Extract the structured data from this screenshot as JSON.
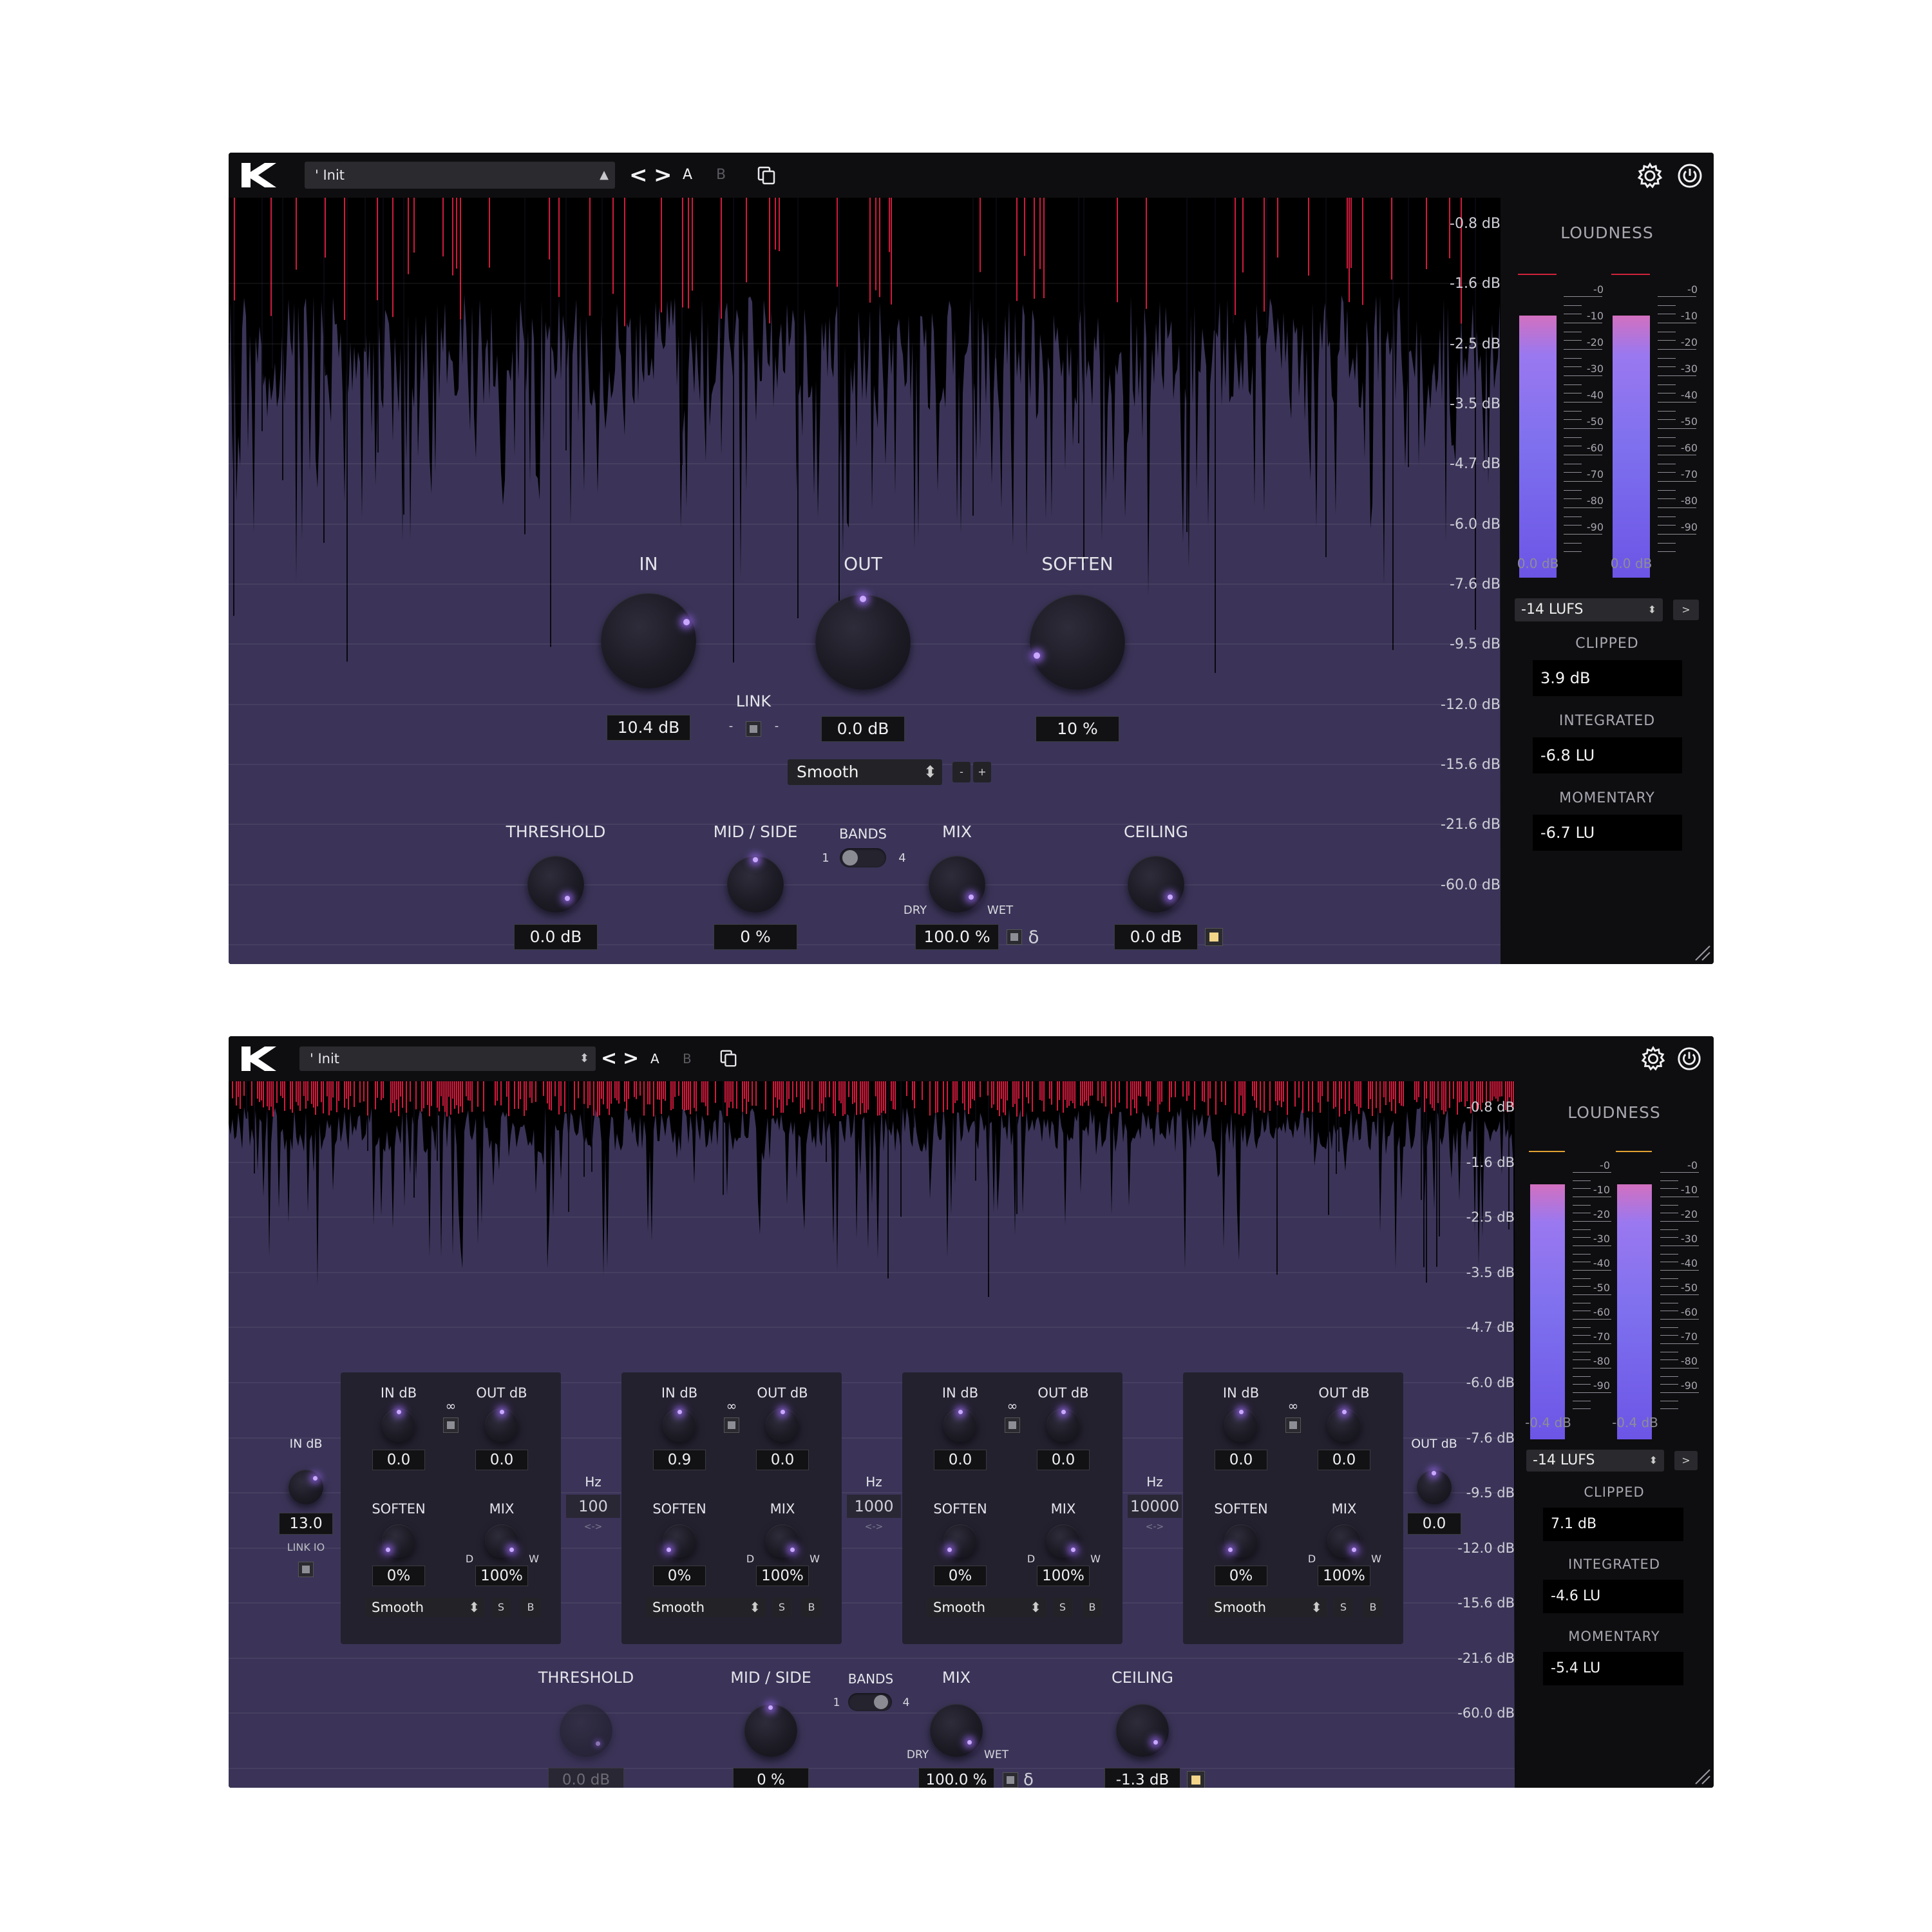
{
  "colors": {
    "accent": "#9b6dff",
    "background": "#3b3458",
    "clip": "#d11a3c",
    "meter_top": "#d270c0",
    "meter_bottom": "#6c55e6"
  },
  "icons": {
    "logo": "k-logo",
    "prev": "chevron-left-icon",
    "next": "chevron-right-icon",
    "copy": "copy-icon",
    "settings": "gear-icon",
    "power": "power-icon"
  },
  "w1": {
    "header": {
      "preset": "' Init",
      "prev": "<",
      "next": ">",
      "a": "A",
      "b": "B"
    },
    "db_scale": [
      "-0.8 dB",
      "-1.6 dB",
      "-2.5 dB",
      "-3.5 dB",
      "-4.7 dB",
      "-6.0 dB",
      "-7.6 dB",
      "-9.5 dB",
      "-12.0 dB",
      "-15.6 dB",
      "-21.6 dB",
      "-60.0 dB"
    ],
    "loudness": {
      "title": "LOUDNESS",
      "ticks": [
        "-0",
        "-10",
        "-20",
        "-30",
        "-40",
        "-50",
        "-60",
        "-70",
        "-80",
        "-90"
      ],
      "left_value": "0.0 dB",
      "right_value": "0.0 dB",
      "left_level": 0.88,
      "right_level": 0.88,
      "mode": "-14 LUFS",
      "mode_btn": ">",
      "clipped_label": "CLIPPED",
      "clipped": "3.9 dB",
      "integrated_label": "INTEGRATED",
      "integrated": "-6.8 LU",
      "momentary_label": "MOMENTARY",
      "momentary": "-6.7 LU"
    },
    "in": {
      "label": "IN",
      "value": "10.4 dB"
    },
    "out": {
      "label": "OUT",
      "value": "0.0 dB"
    },
    "soften": {
      "label": "SOFTEN",
      "value": "10 %"
    },
    "link": {
      "label": "LINK",
      "minus": "-",
      "plus": "-"
    },
    "mode": {
      "value": "Smooth",
      "minus": "-",
      "plus": "+"
    },
    "threshold": {
      "label": "THRESHOLD",
      "value": "0.0 dB"
    },
    "midside": {
      "label": "MID / SIDE",
      "value": "0 %"
    },
    "bands": {
      "label": "BANDS",
      "min": "1",
      "max": "4"
    },
    "mix": {
      "label": "MIX",
      "dry": "DRY",
      "wet": "WET",
      "value": "100.0 %",
      "delta": "δ"
    },
    "ceiling": {
      "label": "CEILING",
      "value": "0.0 dB"
    }
  },
  "w2": {
    "header": {
      "preset": "' Init",
      "prev": "<",
      "next": ">",
      "a": "A",
      "b": "B"
    },
    "db_scale": [
      "-0.8 dB",
      "-1.6 dB",
      "-2.5 dB",
      "-3.5 dB",
      "-4.7 dB",
      "-6.0 dB",
      "-7.6 dB",
      "-9.5 dB",
      "-12.0 dB",
      "-15.6 dB",
      "-21.6 dB",
      "-60.0 dB"
    ],
    "loudness": {
      "title": "LOUDNESS",
      "ticks": [
        "-0",
        "-10",
        "-20",
        "-30",
        "-40",
        "-50",
        "-60",
        "-70",
        "-80",
        "-90"
      ],
      "left_value": "-0.4 dB",
      "right_value": "-0.4 dB",
      "left_level": 0.9,
      "right_level": 0.9,
      "mode": "-14 LUFS",
      "mode_btn": ">",
      "clipped_label": "CLIPPED",
      "clipped": "7.1 dB",
      "integrated_label": "INTEGRATED",
      "integrated": "-4.6 LU",
      "momentary_label": "MOMENTARY",
      "momentary": "-5.4 LU"
    },
    "global_in": {
      "label": "IN dB",
      "value": "13.0",
      "link_label": "LINK IO"
    },
    "global_out": {
      "label": "OUT dB",
      "value": "0.0"
    },
    "bands": [
      {
        "in_label": "IN dB",
        "out_label": "OUT dB",
        "in": "0.0",
        "out": "0.0",
        "link": "∞",
        "soften_label": "SOFTEN",
        "mix_label": "MIX",
        "soften": "0%",
        "mix": "100%",
        "d": "D",
        "w": "W",
        "mode": "Smooth",
        "s": "S",
        "b": "B"
      },
      {
        "in_label": "IN dB",
        "out_label": "OUT dB",
        "in": "0.9",
        "out": "0.0",
        "link": "∞",
        "soften_label": "SOFTEN",
        "mix_label": "MIX",
        "soften": "0%",
        "mix": "100%",
        "d": "D",
        "w": "W",
        "mode": "Smooth",
        "s": "S",
        "b": "B"
      },
      {
        "in_label": "IN dB",
        "out_label": "OUT dB",
        "in": "0.0",
        "out": "0.0",
        "link": "∞",
        "soften_label": "SOFTEN",
        "mix_label": "MIX",
        "soften": "0%",
        "mix": "100%",
        "d": "D",
        "w": "W",
        "mode": "Smooth",
        "s": "S",
        "b": "B"
      },
      {
        "in_label": "IN dB",
        "out_label": "OUT dB",
        "in": "0.0",
        "out": "0.0",
        "link": "∞",
        "soften_label": "SOFTEN",
        "mix_label": "MIX",
        "soften": "0%",
        "mix": "100%",
        "d": "D",
        "w": "W",
        "mode": "Smooth",
        "s": "S",
        "b": "B"
      }
    ],
    "crossovers": [
      {
        "label": "Hz",
        "value": "100",
        "arrows": "<->"
      },
      {
        "label": "Hz",
        "value": "1000",
        "arrows": "<->"
      },
      {
        "label": "Hz",
        "value": "10000",
        "arrows": "<->"
      }
    ],
    "threshold": {
      "label": "THRESHOLD",
      "value": "0.0 dB"
    },
    "midside": {
      "label": "MID / SIDE",
      "value": "0 %"
    },
    "bands_switch": {
      "label": "BANDS",
      "min": "1",
      "max": "4"
    },
    "mix": {
      "label": "MIX",
      "dry": "DRY",
      "wet": "WET",
      "value": "100.0 %",
      "delta": "δ"
    },
    "ceiling": {
      "label": "CEILING",
      "value": "-1.3 dB"
    }
  }
}
